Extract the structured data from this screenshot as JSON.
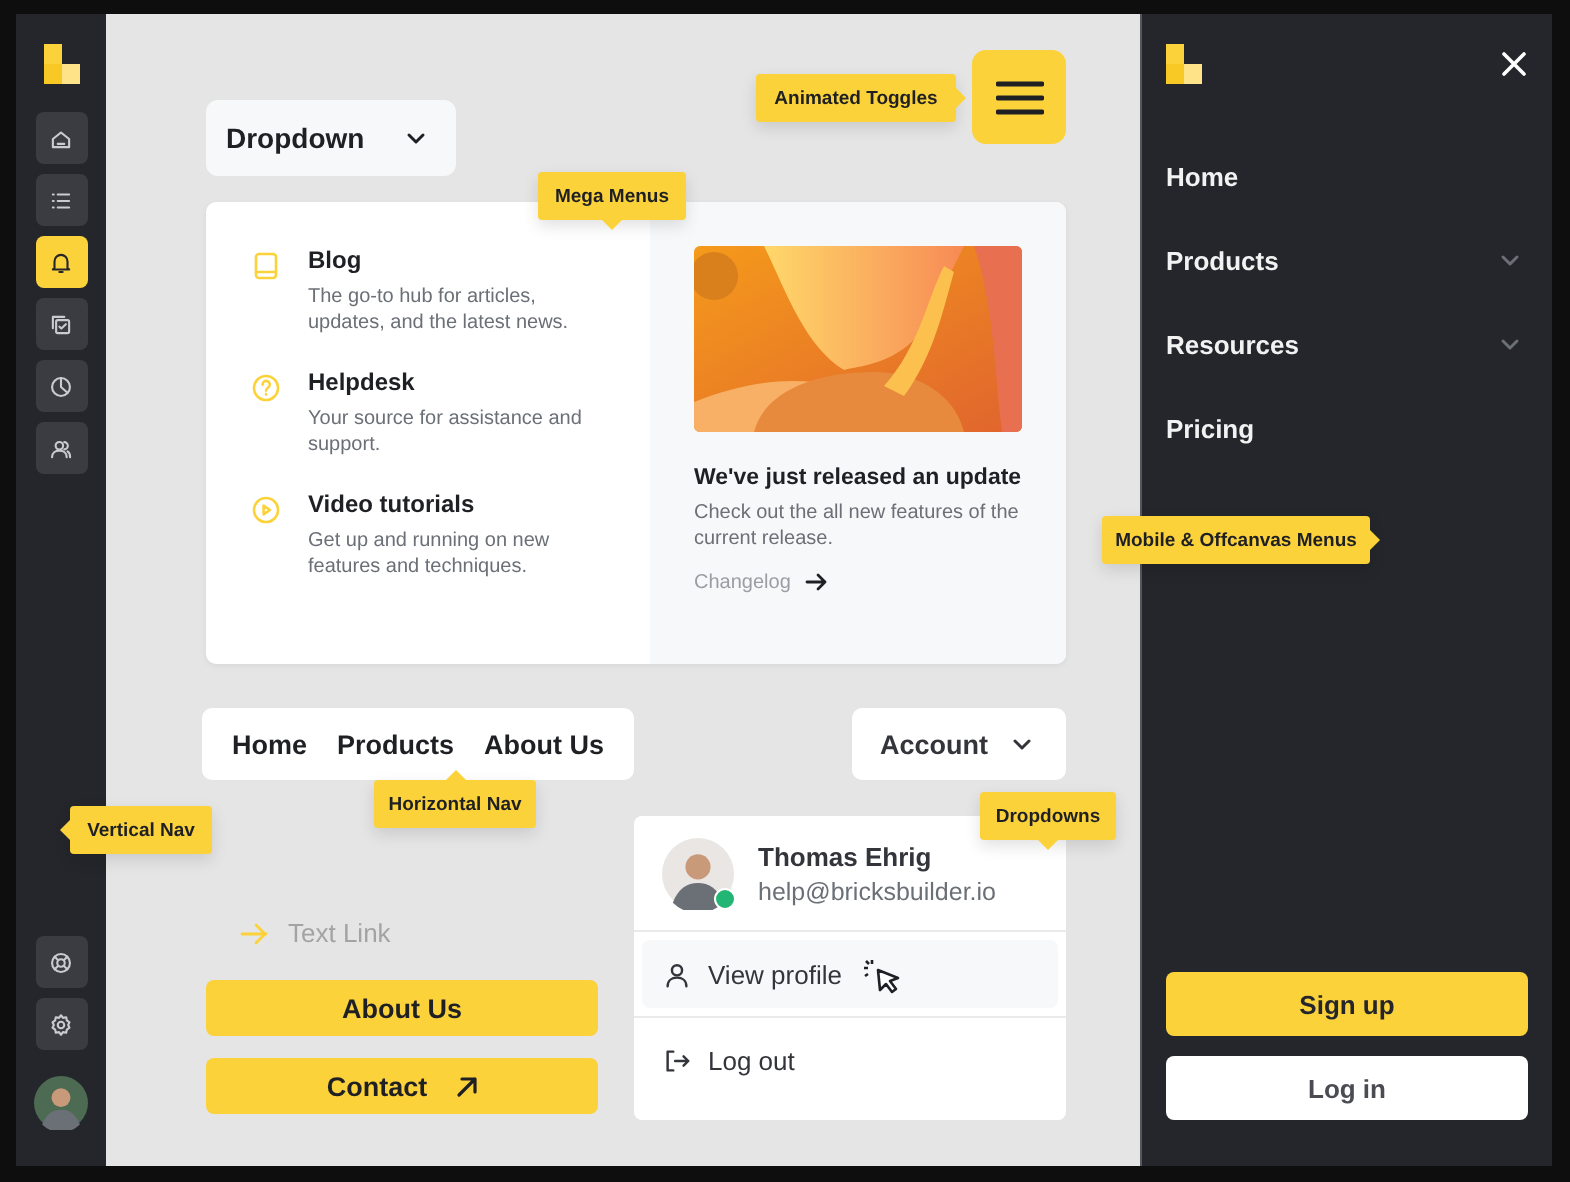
{
  "sidebar": {
    "items": [
      {
        "selected": false
      },
      {
        "selected": false
      },
      {
        "selected": true
      },
      {
        "selected": false
      },
      {
        "selected": false
      },
      {
        "selected": false
      }
    ],
    "bottom_items": [
      {
        "selected": false
      },
      {
        "selected": false
      }
    ]
  },
  "dropdown": {
    "label": "Dropdown"
  },
  "mega_menu": {
    "items": [
      {
        "title": "Blog",
        "description": "The go-to hub for articles, updates, and the latest news."
      },
      {
        "title": "Helpdesk",
        "description": "Your source for assistance and support."
      },
      {
        "title": "Video tutorials",
        "description": "Get up and running on new features and techniques."
      }
    ],
    "feature": {
      "kind": "picture",
      "title": "We've just released an update",
      "description": "Check out the all new features of the current release.",
      "link": "Changelog"
    }
  },
  "horizontal_nav": {
    "items": [
      "Home",
      "Products",
      "About Us"
    ]
  },
  "text_link": "Text Link",
  "buttons": [
    {
      "label": "About Us",
      "arrow": false
    },
    {
      "label": "Contact",
      "arrow": true
    }
  ],
  "account": {
    "label": "Account"
  },
  "profile_menu": {
    "name": "Thomas Ehrig",
    "email": "help@bricksbuilder.io",
    "online": true,
    "items": [
      {
        "label": "View profile",
        "selected": true
      },
      {
        "label": "Log out",
        "selected": false
      }
    ]
  },
  "offcanvas": {
    "items": [
      {
        "label": "Home",
        "kind": "link"
      },
      {
        "label": "Products",
        "kind": "submenu"
      },
      {
        "label": "Resources",
        "kind": "submenu"
      },
      {
        "label": "Pricing",
        "kind": "link"
      }
    ],
    "primary_button": "Sign up",
    "secondary_button": "Log in"
  },
  "callouts": [
    {
      "label": "Animated Toggles"
    },
    {
      "label": "Mega Menus"
    },
    {
      "label": "Mobile & Offcanvas Menus"
    },
    {
      "label": "Vertical Nav"
    },
    {
      "label": "Horizontal Nav"
    },
    {
      "label": "Dropdowns"
    }
  ]
}
